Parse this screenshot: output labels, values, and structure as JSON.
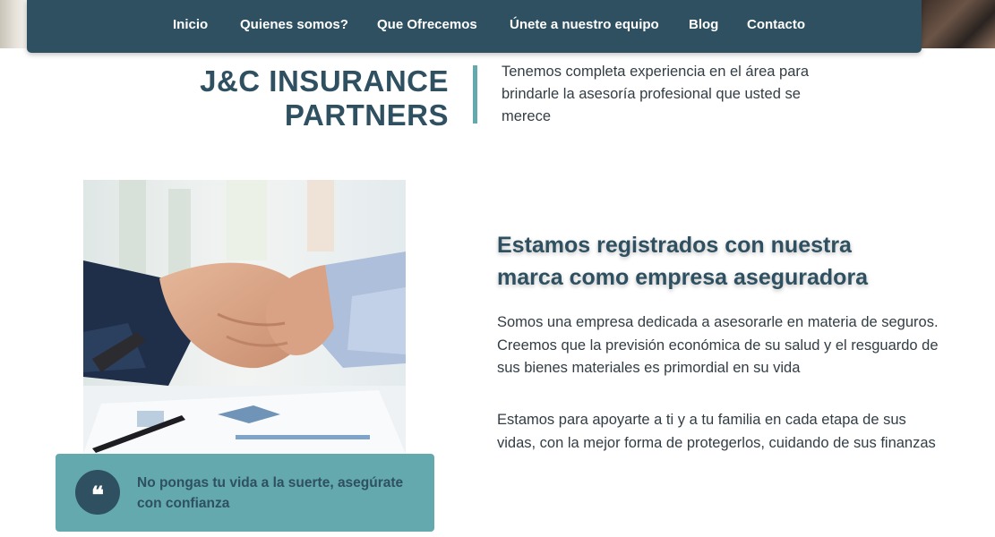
{
  "nav": {
    "items": [
      {
        "label": "Inicio"
      },
      {
        "label": "Quienes somos?"
      },
      {
        "label": "Que Ofrecemos"
      },
      {
        "label": "Únete a nuestro equipo"
      },
      {
        "label": "Blog"
      },
      {
        "label": "Contacto"
      }
    ]
  },
  "hero": {
    "title_line1": "J&C INSURANCE",
    "title_line2": "PARTNERS",
    "tagline": "Tenemos completa experiencia en el área para brindarle la asesoría profesional que usted se merece"
  },
  "about": {
    "heading": "Estamos registrados con nuestra marca como empresa aseguradora",
    "paragraph1": "Somos una empresa dedicada a asesorarle en materia de seguros. Creemos que la previsión económica de su salud y el resguardo de sus bienes materiales es primordial en su vida",
    "paragraph2": "Estamos para apoyarte a ti y a tu familia en cada etapa de sus vidas, con la mejor forma de protegerlos, cuidando de sus finanzas"
  },
  "quote": {
    "icon": "quote-icon",
    "text": "No pongas tu vida a la suerte, asegúrate con confianza"
  },
  "colors": {
    "navy": "#2e5060",
    "teal": "#63a9ae",
    "body_text": "#333d44"
  }
}
